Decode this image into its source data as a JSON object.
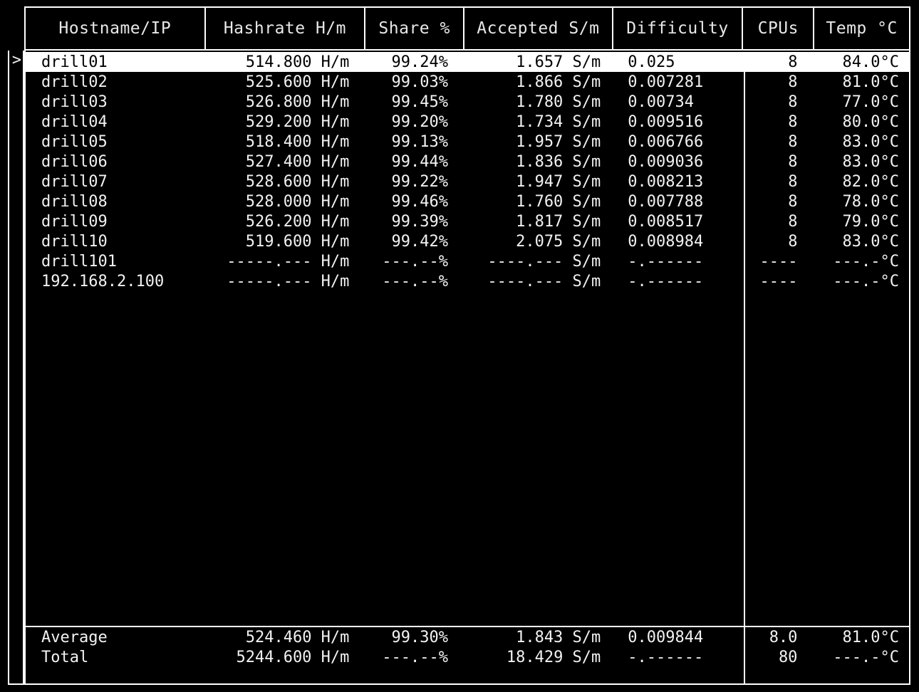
{
  "table": {
    "columns": [
      {
        "key": "host",
        "label": "Hostname/IP"
      },
      {
        "key": "hash",
        "label": "Hashrate H/m"
      },
      {
        "key": "share",
        "label": "Share %"
      },
      {
        "key": "acc",
        "label": "Accepted S/m"
      },
      {
        "key": "diff",
        "label": "Difficulty"
      },
      {
        "key": "cpus",
        "label": "CPUs"
      },
      {
        "key": "temp",
        "label": "Temp °C"
      }
    ],
    "cursor_glyph": ">",
    "selected_index": 0,
    "rows": [
      {
        "host": "drill01",
        "hash": "514.800 H/m",
        "share": "99.24%",
        "acc": "1.657 S/m",
        "diff": "0.025",
        "cpus": "8",
        "temp": "84.0°C"
      },
      {
        "host": "drill02",
        "hash": "525.600 H/m",
        "share": "99.03%",
        "acc": "1.866 S/m",
        "diff": "0.007281",
        "cpus": "8",
        "temp": "81.0°C"
      },
      {
        "host": "drill03",
        "hash": "526.800 H/m",
        "share": "99.45%",
        "acc": "1.780 S/m",
        "diff": "0.00734",
        "cpus": "8",
        "temp": "77.0°C"
      },
      {
        "host": "drill04",
        "hash": "529.200 H/m",
        "share": "99.20%",
        "acc": "1.734 S/m",
        "diff": "0.009516",
        "cpus": "8",
        "temp": "80.0°C"
      },
      {
        "host": "drill05",
        "hash": "518.400 H/m",
        "share": "99.13%",
        "acc": "1.957 S/m",
        "diff": "0.006766",
        "cpus": "8",
        "temp": "83.0°C"
      },
      {
        "host": "drill06",
        "hash": "527.400 H/m",
        "share": "99.44%",
        "acc": "1.836 S/m",
        "diff": "0.009036",
        "cpus": "8",
        "temp": "83.0°C"
      },
      {
        "host": "drill07",
        "hash": "528.600 H/m",
        "share": "99.22%",
        "acc": "1.947 S/m",
        "diff": "0.008213",
        "cpus": "8",
        "temp": "82.0°C"
      },
      {
        "host": "drill08",
        "hash": "528.000 H/m",
        "share": "99.46%",
        "acc": "1.760 S/m",
        "diff": "0.007788",
        "cpus": "8",
        "temp": "78.0°C"
      },
      {
        "host": "drill09",
        "hash": "526.200 H/m",
        "share": "99.39%",
        "acc": "1.817 S/m",
        "diff": "0.008517",
        "cpus": "8",
        "temp": "79.0°C"
      },
      {
        "host": "drill10",
        "hash": "519.600 H/m",
        "share": "99.42%",
        "acc": "2.075 S/m",
        "diff": "0.008984",
        "cpus": "8",
        "temp": "83.0°C"
      },
      {
        "host": "drill101",
        "hash": "-----.--- H/m",
        "share": "---.--%",
        "acc": "----.--- S/m",
        "diff": "-.------",
        "cpus": "----",
        "temp": "---.-°C"
      },
      {
        "host": "192.168.2.100",
        "hash": "-----.--- H/m",
        "share": "---.--%",
        "acc": "----.--- S/m",
        "diff": "-.------",
        "cpus": "----",
        "temp": "---.-°C"
      }
    ],
    "summary": [
      {
        "host": "Average",
        "hash": "524.460 H/m",
        "share": "99.30%",
        "acc": "1.843 S/m",
        "diff": "0.009844",
        "cpus": "8.0",
        "temp": "81.0°C"
      },
      {
        "host": "Total",
        "hash": "5244.600 H/m",
        "share": "---.--%",
        "acc": "18.429 S/m",
        "diff": "-.------",
        "cpus": "80",
        "temp": "---.-°C"
      }
    ]
  },
  "theme": {
    "background": "#000000",
    "foreground": "#f2f2f2",
    "border": "#ffffff",
    "selected_background": "#ffffff",
    "selected_foreground": "#000000"
  }
}
